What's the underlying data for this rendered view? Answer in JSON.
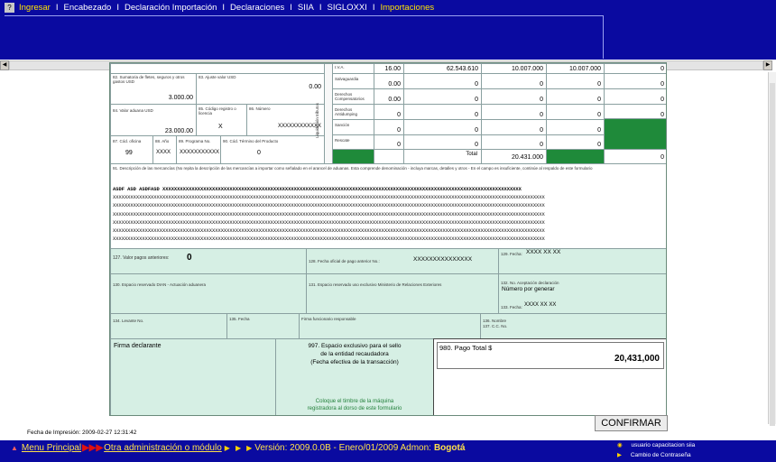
{
  "nav": {
    "help": "?",
    "items": [
      "Ingresar",
      "Encabezado",
      "Declaración Importación",
      "Declaraciones",
      "SIIA",
      "SIGLOXXI",
      "Importaciones"
    ],
    "separator": "I"
  },
  "form": {
    "l82": "82. Sumatoria de fletes, seguros y otros gastos USD",
    "v82": "3.000.00",
    "l83": "83. Ajuste valor USD",
    "v83": "0.00",
    "l84": "84. Valor aduana USD",
    "v84": "23.000.00",
    "l85": "85. Código registro o licencia",
    "v85": "X",
    "l86": "86. Número",
    "v86": "XXXXXXXXXXXX",
    "l87": "87. Cód. oficina",
    "v87": "99",
    "l88": "88. Año",
    "v88": "XXXX",
    "l89": "89. Programa No.",
    "v89": "XXXXXXXXXXX",
    "l90": "90. Cód. Término del Producto",
    "v90": "0",
    "side": "Liquidación tributos",
    "tax_rows": [
      {
        "name": "I.V.A.",
        "rate": "16.00",
        "base": "62.543.610",
        "liq": "10.007.000",
        "paid": "10.007.000",
        "other": "0"
      },
      {
        "name": "Salvaguardia",
        "rate": "0.00",
        "base": "0",
        "liq": "0",
        "paid": "0",
        "other": "0"
      },
      {
        "name": "Derechos Compensatorios",
        "rate": "0.00",
        "base": "0",
        "liq": "0",
        "paid": "0",
        "other": "0"
      },
      {
        "name": "Derechos Antidumping",
        "rate": "0",
        "base": "0",
        "liq": "0",
        "paid": "0",
        "other": "0"
      },
      {
        "name": "Sanción",
        "rate": "0",
        "base": "0",
        "liq": "0",
        "paid": "0",
        "other": ""
      },
      {
        "name": "Rescate",
        "rate": "0",
        "base": "0",
        "liq": "0",
        "paid": "0",
        "other": ""
      }
    ],
    "total_label": "Total",
    "total_value": "20.431.000",
    "total_other": "0",
    "l91": "91. Descripción de las mercancías (No repita la descripción de las mercancías a importar como señalado en el arancel de aduanas. Esta comprende denominación - incluya marcas, detalles y otros - En el campo es insuficiente, continúe al respaldo de este formulario",
    "desc_first": "ASDF ASD ASDFASD XXXXXXXXXXXXXXXXXXXXXXXXXXXXXXXXXXXXXXXXXXXXXXXXXXXXXXXXXXXXXXXXXXXXXXXXXXXXXXXXXXXXXXXXXXXXXXXXXXXXXXXXXXXXXXXXXXXXXXXXXXX",
    "desc_line": "XXXXXXXXXXXXXXXXXXXXXXXXXXXXXXXXXXXXXXXXXXXXXXXXXXXXXXXXXXXXXXXXXXXXXXXXXXXXXXXXXXXXXXXXXXXXXXXXXXXXXXXXXXXXXXXXXXXXXXXXXXXXXXXXXXXXXXXXXXXXXXXXXXXX",
    "l127": "127. Valor pagos anteriores:",
    "v127": "0",
    "l128": "128. Fecha oficial de pago anterior No.:",
    "v128": "XXXXXXXXXXXXXXX",
    "l129": "129. Fecha:",
    "v129": "XXXX XX XX",
    "l130": "130. Espacio reservado DIAN - Actuación aduanera",
    "l131": "131. Espacio reservado uso exclusivo Ministerio de Relaciones Exteriores",
    "l132": "132. No. Aceptación declaración",
    "v132": "Número por generar",
    "l133": "133. Fecha:",
    "v133": "XXXX XX XX",
    "l134": "134. Levante No.",
    "l135": "135. Fecha",
    "l_func": "Firma funcionario responsable",
    "l136": "136. Nombre",
    "l137": "137. C.C. No.",
    "firma": "Firma declarante",
    "l997_1": "997. Espacio exclusivo para el sello",
    "l997_2": "de la entidad recaudadora",
    "l997_3": "(Fecha efectiva de la transacción)",
    "stamp1": "Coloque el timbre de la máquina",
    "stamp2": "registradora al dorso de este formulario",
    "l980": "980. Pago Total $",
    "v980": "20,431,000"
  },
  "print_date": "Fecha de Impresión: 2009-02-27 12:31:42",
  "confirm": "CONFIRMAR",
  "footer": {
    "menu": "Menu Principal",
    "other": "Otra administración o módulo",
    "version": "Versión: 2009.0.0B - Enero/01/2009 Admon:",
    "admon": "Bogotá",
    "user": "usuario capacitacion siia",
    "password": "Cambio de Contraseña"
  }
}
